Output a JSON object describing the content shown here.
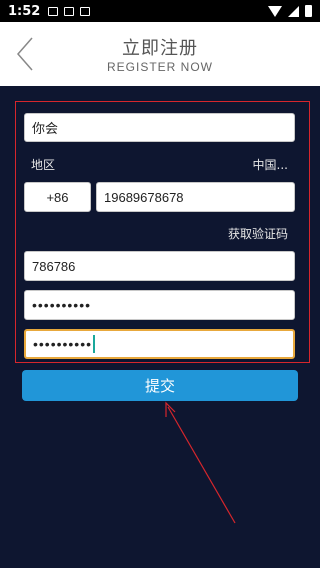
{
  "status_bar": {
    "time": "1:52"
  },
  "header": {
    "title": "立即注册",
    "subtitle": "REGISTER NOW"
  },
  "form": {
    "name_value": "你会",
    "region_label": "地区",
    "region_value": "中国...",
    "country_code": "+86",
    "phone_value": "19689678678",
    "get_code_label": "获取验证码",
    "verify_code_value": "786786",
    "password_value": "••••••••••",
    "confirm_password_value": "••••••••••"
  },
  "submit_label": "提交",
  "colors": {
    "accent": "#2196d8",
    "highlight_box": "#d6262c",
    "focus_border": "#e8a83c"
  }
}
